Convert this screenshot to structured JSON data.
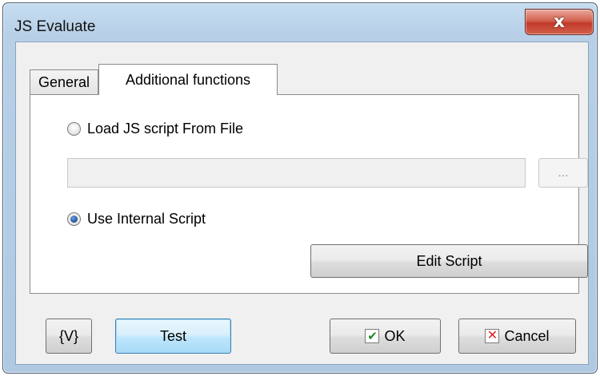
{
  "window": {
    "title": "JS Evaluate",
    "close_glyph": "x"
  },
  "tabs": [
    {
      "label": "General",
      "active": false
    },
    {
      "label": "Additional functions",
      "active": true
    }
  ],
  "panel": {
    "load_from_file_label": "Load JS script From File",
    "load_from_file_checked": false,
    "file_path_value": "",
    "browse_label": "...",
    "use_internal_label": "Use Internal Script",
    "use_internal_checked": true,
    "edit_script_label": "Edit Script"
  },
  "footer": {
    "variables_label": "{V}",
    "test_label": "Test",
    "ok_label": "OK",
    "ok_icon": "check-icon",
    "cancel_label": "Cancel",
    "cancel_icon": "x-icon"
  },
  "colors": {
    "frame": "#b7d0e8",
    "close_button": "#c2392a",
    "focus_button": "#bee6fd",
    "ok_check": "#1f8a1f",
    "cancel_x": "#dd2222"
  }
}
